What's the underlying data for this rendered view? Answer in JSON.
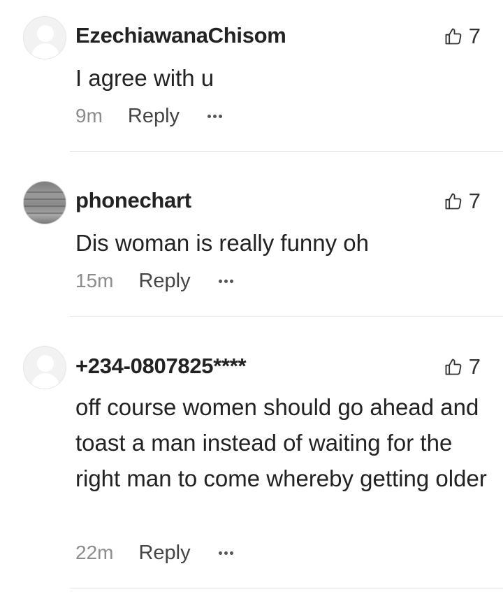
{
  "comments": [
    {
      "username": "EzechiawanaChisom",
      "text": "I agree with u",
      "time": "9m",
      "reply_label": "Reply",
      "likes": "7",
      "avatar": "default-avatar-icon"
    },
    {
      "username": "phonechart",
      "text": "Dis woman is really funny oh",
      "time": "15m",
      "reply_label": "Reply",
      "likes": "7",
      "avatar": "photo-avatar"
    },
    {
      "username": "+234-0807825****",
      "text": "off course women should go ahead and toast a man instead of waiting for the right man to come whereby getting older",
      "time": "22m",
      "reply_label": "Reply",
      "likes": "7",
      "avatar": "default-avatar-icon"
    }
  ],
  "icons": {
    "like": "thumbs-up-outline-icon",
    "more": "more-options-icon"
  },
  "colors": {
    "text": "#222222",
    "muted": "#8c8c8c",
    "divider": "#e3e3e3"
  }
}
